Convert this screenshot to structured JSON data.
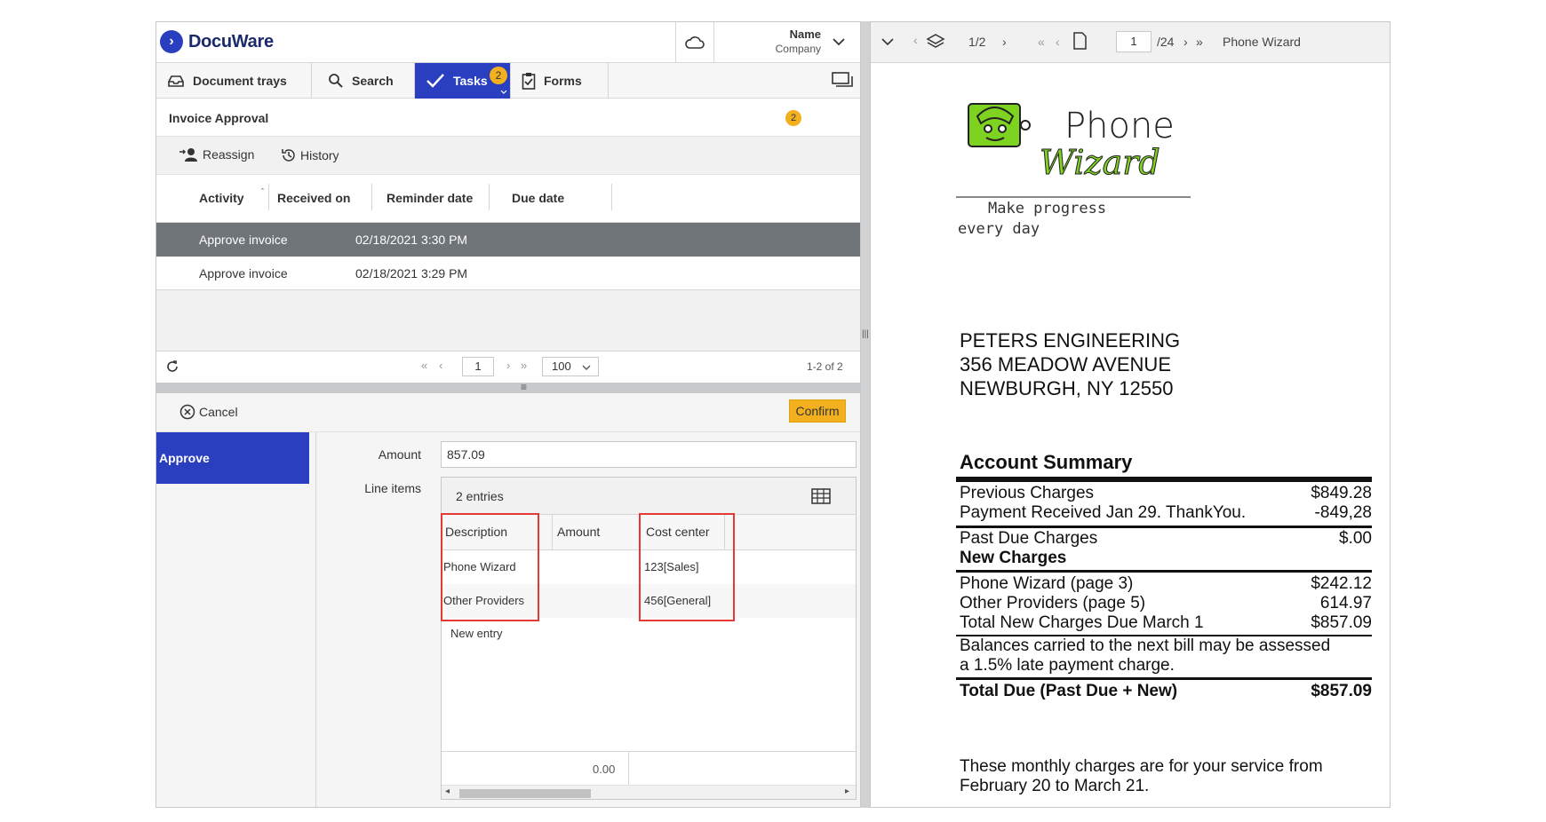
{
  "app": {
    "logo_text": "DocuWare",
    "user_name": "Name",
    "user_company": "Company"
  },
  "nav": {
    "tabs": [
      {
        "label": "Document trays",
        "icon": "tray-icon"
      },
      {
        "label": "Search",
        "icon": "search-icon"
      },
      {
        "label": "Tasks",
        "icon": "check-icon",
        "badge": "2",
        "active": true
      },
      {
        "label": "Forms",
        "icon": "clipboard-icon"
      }
    ]
  },
  "task": {
    "title": "Invoice Approval",
    "badge": "2",
    "toolbar": {
      "reassign": "Reassign",
      "history": "History"
    },
    "columns": [
      "Activity",
      "Received on",
      "Reminder date",
      "Due date"
    ],
    "rows": [
      {
        "activity": "Approve invoice",
        "received": "02/18/2021 3:30 PM",
        "selected": true
      },
      {
        "activity": "Approve invoice",
        "received": "02/18/2021 3:29 PM",
        "selected": false
      }
    ],
    "pager": {
      "page": "1",
      "page_size": "100",
      "range": "1-2 of 2"
    }
  },
  "form": {
    "cancel": "Cancel",
    "confirm": "Confirm",
    "side_tab": "Approve",
    "amount_label": "Amount",
    "amount_value": "857.09",
    "line_items_label": "Line items",
    "entries": "2 entries",
    "li_columns": [
      "Description",
      "Amount",
      "Cost center"
    ],
    "li_rows": [
      {
        "description": "Phone Wizard",
        "amount": "",
        "cost_center": "123[Sales]"
      },
      {
        "description": "Other Providers",
        "amount": "",
        "cost_center": "456[General]"
      }
    ],
    "new_entry": "New entry",
    "total": "0.00"
  },
  "viewer": {
    "doc_counter": "1/2",
    "page_value": "1",
    "page_total": "/24",
    "doc_name": "Phone Wizard"
  },
  "document": {
    "logo_line1": "Phone",
    "logo_line2": "Wizard",
    "tagline1": "Make progress",
    "tagline2": "every day",
    "address": [
      "PETERS ENGINEERING",
      "356 MEADOW AVENUE",
      "NEWBURGH, NY 12550"
    ],
    "summary_title": "Account Summary",
    "lines": [
      {
        "label": "Previous Charges",
        "amount": "$849.28"
      },
      {
        "label": "Payment Received Jan 29. ThankYou.",
        "amount": "-849,28"
      },
      {
        "label": "Past Due Charges",
        "amount": "$.00"
      },
      {
        "label": "New Charges",
        "amount": ""
      },
      {
        "label": "Phone Wizard (page 3)",
        "amount": "$242.12"
      },
      {
        "label": "Other Providers (page 5)",
        "amount": "614.97"
      },
      {
        "label": "Total New Charges Due March 1",
        "amount": "$857.09"
      },
      {
        "label": "Balances carried to the next bill may be assessed",
        "amount": ""
      },
      {
        "label": "a 1.5% late payment charge.",
        "amount": ""
      },
      {
        "label": "Total Due (Past Due + New)",
        "amount": "$857.09"
      }
    ],
    "footer1": "These monthly charges are for your service from",
    "footer2": "February 20 to March 21."
  },
  "colors": {
    "brand": "#2a3fbf",
    "accent": "#f2b01e",
    "highlight": "#e53935"
  }
}
